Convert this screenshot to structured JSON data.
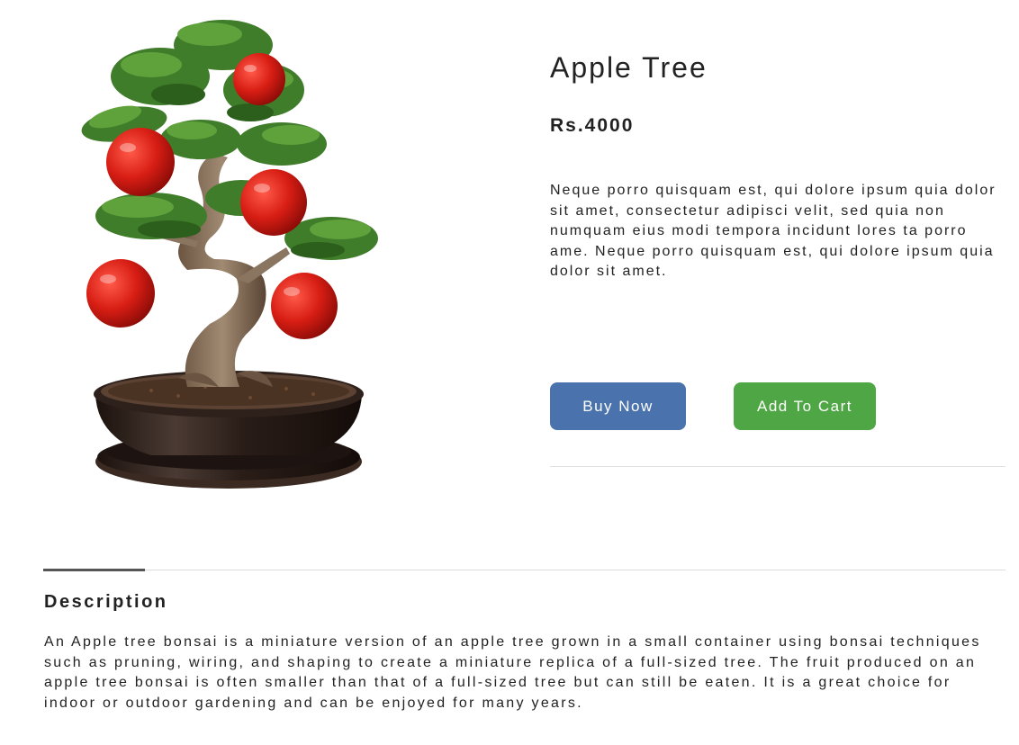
{
  "product": {
    "title": "Apple Tree",
    "price": "Rs.4000",
    "summary": "Neque porro quisquam est, qui dolore ipsum quia dolor sit amet, consectetur adipisci velit, sed quia non numquam eius modi tempora incidunt lores ta porro ame. Neque porro quisquam est, qui dolore ipsum quia dolor sit amet.",
    "image_subject": "apple tree bonsai in ceramic pot"
  },
  "actions": {
    "buy_now": "Buy Now",
    "add_to_cart": "Add To Cart"
  },
  "description": {
    "heading": "Description",
    "text": "An Apple tree bonsai is a miniature version of an apple tree grown in a small container using bonsai techniques such as pruning, wiring, and shaping to create a miniature replica of a full-sized tree. The fruit produced on an apple tree bonsai is often smaller than that of a full-sized tree but can still be eaten. It is a great choice for indoor or outdoor gardening and can be enjoyed for many years."
  },
  "colors": {
    "buy_button": "#4a72ad",
    "cart_button": "#4fa644",
    "text": "#222222"
  }
}
